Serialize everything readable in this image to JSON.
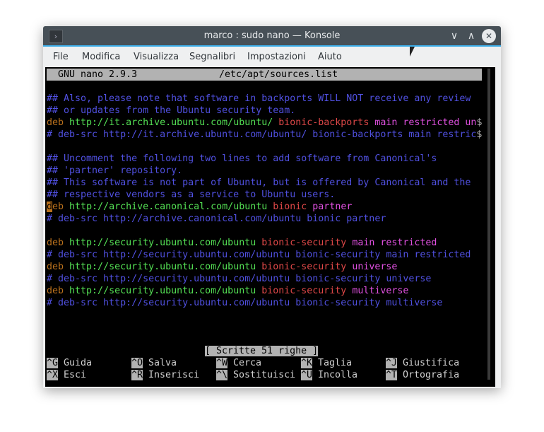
{
  "window": {
    "title": "marco : sudo nano — Konsole"
  },
  "menu": [
    "File",
    "Modifica",
    "Visualizza",
    "Segnalibri",
    "Impostazioni",
    "Aiuto"
  ],
  "nano": {
    "version": "GNU nano 2.9.3",
    "file": "/etc/apt/sources.list",
    "status": "[ Scritte 51 righe ]"
  },
  "colors": {
    "comment": "#5050e0",
    "deb": "#b8701c",
    "url": "#54e054",
    "suite": "#e04848",
    "component": "#e050e0"
  },
  "lines": [
    [],
    [
      [
        "c",
        "## Also, please note that software in backports WILL NOT receive any review"
      ]
    ],
    [
      [
        "c",
        "## or updates from the Ubuntu security team."
      ]
    ],
    [
      [
        "d",
        "deb "
      ],
      [
        "u",
        "http://it.archive.ubuntu.com/ubuntu/ "
      ],
      [
        "s",
        "bionic-backports "
      ],
      [
        "m",
        "main restricted un"
      ],
      [
        "g",
        "$"
      ]
    ],
    [
      [
        "c",
        "# deb-src http://it.archive.ubuntu.com/ubuntu/ bionic-backports main restric"
      ],
      [
        "g",
        "$"
      ]
    ],
    [],
    [
      [
        "c",
        "## Uncomment the following two lines to add software from Canonical's"
      ]
    ],
    [
      [
        "c",
        "## 'partner' repository."
      ]
    ],
    [
      [
        "c",
        "## This software is not part of Ubuntu, but is offered by Canonical and the"
      ]
    ],
    [
      [
        "c",
        "## respective vendors as a service to Ubuntu users."
      ]
    ],
    [
      [
        "cur",
        "d"
      ],
      [
        "d",
        "eb "
      ],
      [
        "u",
        "http://archive.canonical.com/ubuntu "
      ],
      [
        "s",
        "bionic "
      ],
      [
        "m",
        "partner"
      ]
    ],
    [
      [
        "c",
        "# deb-src http://archive.canonical.com/ubuntu bionic partner"
      ]
    ],
    [],
    [
      [
        "d",
        "deb "
      ],
      [
        "u",
        "http://security.ubuntu.com/ubuntu "
      ],
      [
        "s",
        "bionic-security "
      ],
      [
        "m",
        "main restricted"
      ]
    ],
    [
      [
        "c",
        "# deb-src http://security.ubuntu.com/ubuntu bionic-security main restricted"
      ]
    ],
    [
      [
        "d",
        "deb "
      ],
      [
        "u",
        "http://security.ubuntu.com/ubuntu "
      ],
      [
        "s",
        "bionic-security "
      ],
      [
        "m",
        "universe"
      ]
    ],
    [
      [
        "c",
        "# deb-src http://security.ubuntu.com/ubuntu bionic-security universe"
      ]
    ],
    [
      [
        "d",
        "deb "
      ],
      [
        "u",
        "http://security.ubuntu.com/ubuntu "
      ],
      [
        "s",
        "bionic-security "
      ],
      [
        "m",
        "multiverse"
      ]
    ],
    [
      [
        "c",
        "# deb-src http://security.ubuntu.com/ubuntu bionic-security multiverse"
      ]
    ]
  ],
  "shortcuts": [
    [
      {
        "key": "^G",
        "label": "Guida"
      },
      {
        "key": "^O",
        "label": "Salva"
      },
      {
        "key": "^W",
        "label": "Cerca"
      },
      {
        "key": "^K",
        "label": "Taglia"
      },
      {
        "key": "^J",
        "label": "Giustifica"
      }
    ],
    [
      {
        "key": "^X",
        "label": "Esci"
      },
      {
        "key": "^R",
        "label": "Inserisci"
      },
      {
        "key": "^\\",
        "label": "Sostituisci"
      },
      {
        "key": "^U",
        "label": "Incolla"
      },
      {
        "key": "^T",
        "label": "Ortografia"
      }
    ]
  ]
}
